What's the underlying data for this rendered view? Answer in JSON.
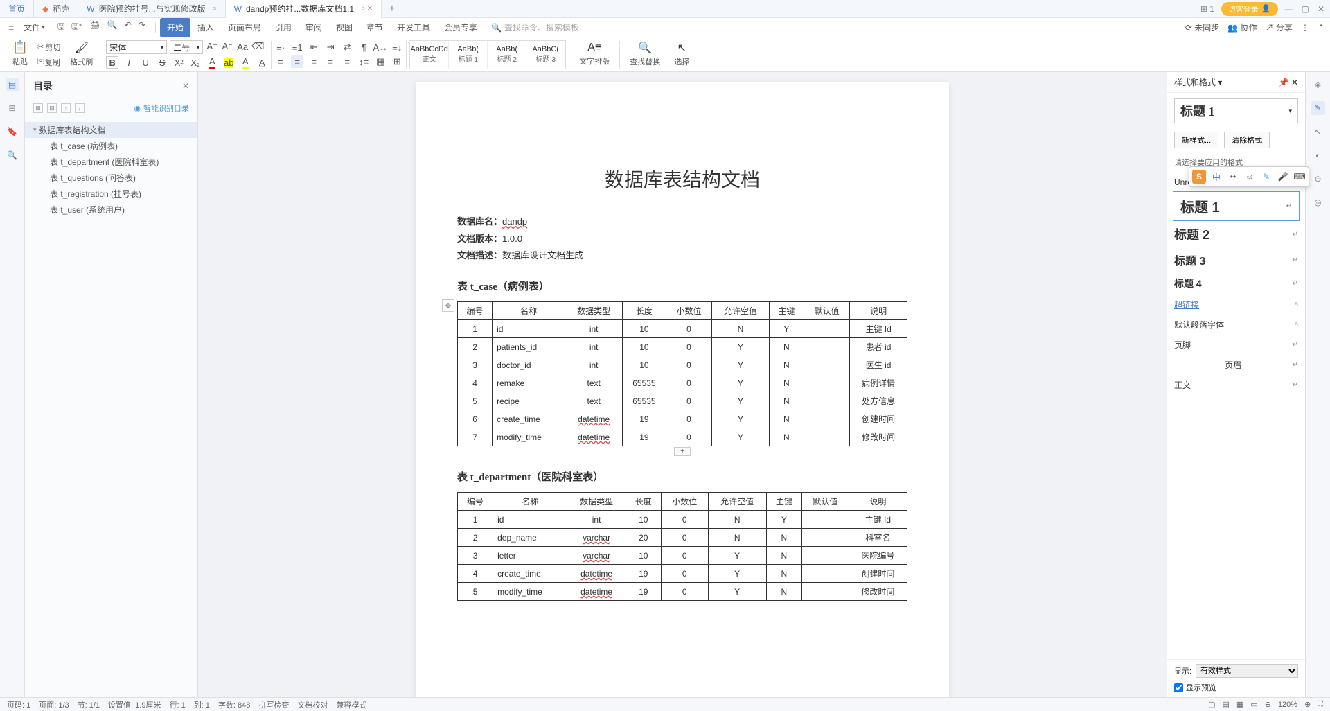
{
  "tabs": [
    {
      "label": "首页",
      "type": "home"
    },
    {
      "label": "稻壳",
      "type": "docer"
    },
    {
      "label": "医院预约挂号...与实现修改版",
      "type": "doc"
    },
    {
      "label": "dandp预约挂...数据库文档1.1",
      "type": "doc",
      "active": true
    }
  ],
  "titlebar": {
    "login": "访客登录"
  },
  "menu": {
    "file": "文件",
    "tabs": [
      "开始",
      "插入",
      "页面布局",
      "引用",
      "审阅",
      "视图",
      "章节",
      "开发工具",
      "会员专享"
    ],
    "active_tab": "开始",
    "search_placeholder": "查找命令、搜索模板",
    "right": [
      "未同步",
      "协作",
      "分享"
    ]
  },
  "clipboard": {
    "paste": "粘贴",
    "cut": "剪切",
    "copy": "复制",
    "format": "格式刷"
  },
  "font": {
    "name": "宋体",
    "size": "二号"
  },
  "styles_gallery": [
    {
      "preview": "AaBbCcDd",
      "name": "正文"
    },
    {
      "preview": "AaBb(",
      "name": "标题 1"
    },
    {
      "preview": "AaBb(",
      "name": "标题 2"
    },
    {
      "preview": "AaBbC(",
      "name": "标题 3"
    }
  ],
  "toolbar_right": {
    "layout": "文字排版",
    "find": "查找替换",
    "select": "选择"
  },
  "outline": {
    "title": "目录",
    "smart": "智能识别目录",
    "items": [
      {
        "label": "数据库表结构文档",
        "level": 0,
        "selected": true,
        "expanded": true
      },
      {
        "label": "表 t_case (病例表)",
        "level": 1
      },
      {
        "label": "表 t_department (医院科室表)",
        "level": 1
      },
      {
        "label": "表 t_questions (问答表)",
        "level": 1
      },
      {
        "label": "表 t_registration (挂号表)",
        "level": 1
      },
      {
        "label": "表 t_user (系统用户)",
        "level": 1
      }
    ]
  },
  "document": {
    "title": "数据库表结构文档",
    "meta": {
      "db_label": "数据库名：",
      "db_value": "dandp",
      "ver_label": "文档版本：",
      "ver_value": "1.0.0",
      "desc_label": "文档描述：",
      "desc_value": "数据库设计文档生成"
    },
    "table1": {
      "heading": "表 t_case（病例表）",
      "headers": [
        "编号",
        "名称",
        "数据类型",
        "长度",
        "小数位",
        "允许空值",
        "主键",
        "默认值",
        "说明"
      ],
      "rows": [
        [
          "1",
          "id",
          "int",
          "10",
          "0",
          "N",
          "Y",
          "",
          "主键 Id"
        ],
        [
          "2",
          "patients_id",
          "int",
          "10",
          "0",
          "Y",
          "N",
          "",
          "患者 id"
        ],
        [
          "3",
          "doctor_id",
          "int",
          "10",
          "0",
          "Y",
          "N",
          "",
          "医生 id"
        ],
        [
          "4",
          "remake",
          "text",
          "65535",
          "0",
          "Y",
          "N",
          "",
          "病例详情"
        ],
        [
          "5",
          "recipe",
          "text",
          "65535",
          "0",
          "Y",
          "N",
          "",
          "处方信息"
        ],
        [
          "6",
          "create_time",
          "datetime",
          "19",
          "0",
          "Y",
          "N",
          "",
          "创建时间"
        ],
        [
          "7",
          "modify_time",
          "datetime",
          "19",
          "0",
          "Y",
          "N",
          "",
          "修改时间"
        ]
      ]
    },
    "table2": {
      "heading": "表 t_department（医院科室表）",
      "headers": [
        "编号",
        "名称",
        "数据类型",
        "长度",
        "小数位",
        "允许空值",
        "主键",
        "默认值",
        "说明"
      ],
      "rows": [
        [
          "1",
          "id",
          "int",
          "10",
          "0",
          "N",
          "Y",
          "",
          "主键 Id"
        ],
        [
          "2",
          "dep_name",
          "varchar",
          "20",
          "0",
          "N",
          "N",
          "",
          "科室名"
        ],
        [
          "3",
          "letter",
          "varchar",
          "10",
          "0",
          "Y",
          "N",
          "",
          "医院编号"
        ],
        [
          "4",
          "create_time",
          "datetime",
          "19",
          "0",
          "Y",
          "N",
          "",
          "创建时间"
        ],
        [
          "5",
          "modify_time",
          "datetime",
          "19",
          "0",
          "Y",
          "N",
          "",
          "修改时间"
        ]
      ]
    }
  },
  "styles_panel": {
    "title": "样式和格式",
    "current": "标题 1",
    "new_btn": "新样式...",
    "clear_btn": "清除格式",
    "choose_label": "请选择要应用的格式",
    "unresolved": "Unresolved M",
    "items": [
      {
        "text": "标题 1",
        "cls": "sp-heading1",
        "selected": true
      },
      {
        "text": "标题 2",
        "cls": "sp-heading2"
      },
      {
        "text": "标题 3",
        "cls": "sp-heading3"
      },
      {
        "text": "标题 4",
        "cls": "sp-heading4"
      },
      {
        "text": "超链接",
        "cls": "sp-link",
        "sym": "a"
      },
      {
        "text": "默认段落字体",
        "cls": "",
        "sym": "a"
      },
      {
        "text": "页脚",
        "cls": ""
      },
      {
        "text": "页眉",
        "cls": "",
        "center": true
      },
      {
        "text": "正文",
        "cls": ""
      }
    ],
    "display_label": "显示:",
    "display_value": "有效样式",
    "preview_label": "显示预览"
  },
  "statusbar": {
    "items": [
      "页码: 1",
      "页面: 1/3",
      "节: 1/1",
      "设置值: 1.9厘米",
      "行: 1",
      "列: 1",
      "字数: 848",
      "拼写检查",
      "文档校对",
      "兼容模式"
    ],
    "zoom": "120%"
  }
}
